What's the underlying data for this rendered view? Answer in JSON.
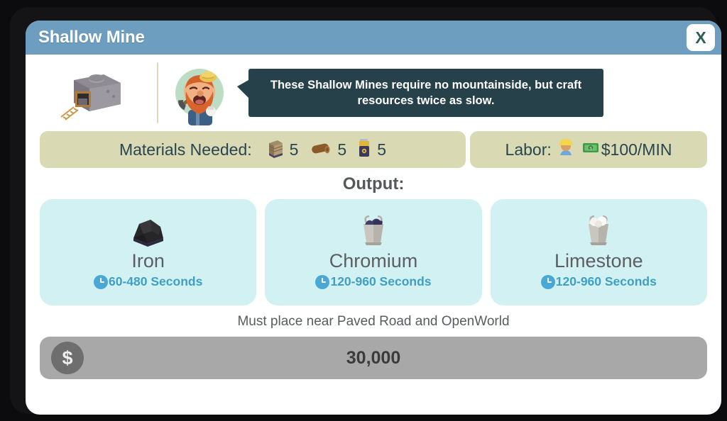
{
  "window": {
    "title": "Shallow Mine",
    "close_label": "X",
    "titlebar_color": "#6d9ec0"
  },
  "info": {
    "building_icon": "mine-building-icon",
    "avatar_icon": "miner-avatar-icon",
    "tooltip": "These Shallow Mines require no mountainside, but craft resources twice as slow.",
    "tooltip_color": "#27414a"
  },
  "materials": {
    "label": "Materials Needed:",
    "items": [
      {
        "icon": "wood-planks-icon",
        "glyph": "🪵",
        "count": "5"
      },
      {
        "icon": "log-icon",
        "glyph": "🪵",
        "count": "5"
      },
      {
        "icon": "battery-icon",
        "glyph": "🔋",
        "count": "5"
      }
    ]
  },
  "labor": {
    "label": "Labor:",
    "worker_icon": "construction-worker-icon",
    "money_icon": "money-icon",
    "rate": "$100/MIN"
  },
  "output": {
    "heading": "Output:",
    "cards": [
      {
        "icon": "iron-ore-icon",
        "glyph": "⛰",
        "name": "Iron",
        "time": "60-480 Seconds"
      },
      {
        "icon": "chromium-bucket-icon",
        "glyph": "🪣",
        "name": "Chromium",
        "time": "120-960 Seconds"
      },
      {
        "icon": "limestone-bucket-icon",
        "glyph": "🪣",
        "name": "Limestone",
        "time": "120-960 Seconds"
      }
    ],
    "card_color": "#d2f1f3",
    "time_color": "#3f9fc4"
  },
  "footer": {
    "requirement": "Must place near Paved Road and OpenWorld",
    "price": "30,000",
    "currency_symbol": "$",
    "buy_bar_color": "#a8a8a8"
  }
}
